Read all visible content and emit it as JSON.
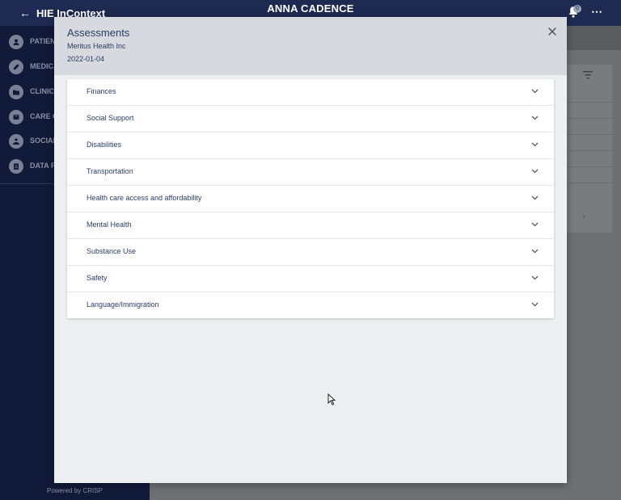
{
  "header": {
    "app_title": "HIE InContext",
    "patient_name": "ANNA CADENCE",
    "notification_count": "0",
    "back_icon": "arrow-left-icon",
    "bell_icon": "bell-icon",
    "more_icon": "more-horizontal-icon"
  },
  "sidebar": {
    "items": [
      {
        "label": "PATIENT",
        "icon": "person-icon"
      },
      {
        "label": "MEDICA",
        "icon": "pill-icon"
      },
      {
        "label": "CLINICA",
        "icon": "folder-icon"
      },
      {
        "label": "CARE C",
        "icon": "care-icon"
      },
      {
        "label": "SOCIAL",
        "icon": "social-icon"
      },
      {
        "label": "DATA FI",
        "icon": "clipboard-icon"
      }
    ],
    "footer": "Powered by CRISP"
  },
  "modal": {
    "title": "Assessments",
    "organization": "Meritus Health Inc",
    "date": "2022-01-04",
    "close_icon": "close-icon",
    "sections": [
      {
        "label": "Finances"
      },
      {
        "label": "Social Support"
      },
      {
        "label": "Disabilities"
      },
      {
        "label": "Transportation"
      },
      {
        "label": "Health care access and affordability"
      },
      {
        "label": "Mental Health"
      },
      {
        "label": "Substance Use"
      },
      {
        "label": "Safety"
      },
      {
        "label": "Language/Immigration"
      }
    ]
  },
  "colors": {
    "topbar": "#1e2a52",
    "sidebar": "#111a38",
    "modal_header": "#d6d9de",
    "modal_body": "#eeeff0",
    "accent_text": "#2a3c68"
  }
}
